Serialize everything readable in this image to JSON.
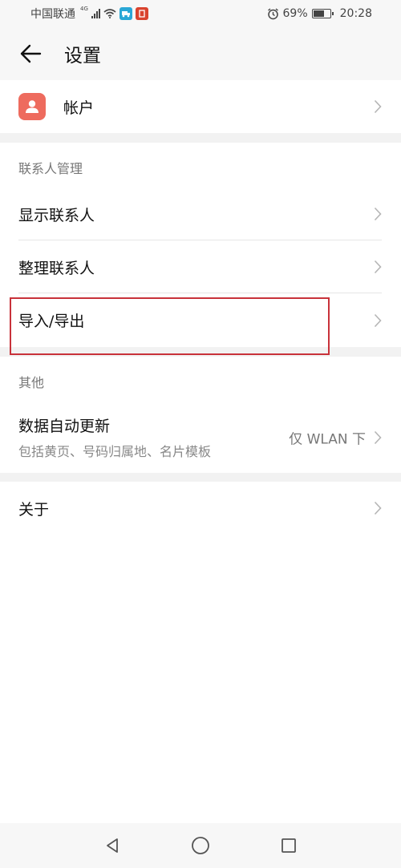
{
  "status_bar": {
    "carrier": "中国联通",
    "network": "4G",
    "battery_text": "69%",
    "battery_level": 0.69,
    "time": "20:28"
  },
  "header": {
    "title": "设置"
  },
  "account": {
    "label": "帐户"
  },
  "contacts_section": {
    "title": "联系人管理",
    "items": [
      {
        "label": "显示联系人"
      },
      {
        "label": "整理联系人"
      },
      {
        "label": "导入/导出"
      }
    ]
  },
  "other_section": {
    "title": "其他",
    "data_update": {
      "label": "数据自动更新",
      "sublabel": "包括黄页、号码归属地、名片模板",
      "value": "仅 WLAN 下"
    }
  },
  "about": {
    "label": "关于"
  },
  "colors": {
    "accent": "#ee6b5e",
    "highlight_border": "#c8323a"
  }
}
